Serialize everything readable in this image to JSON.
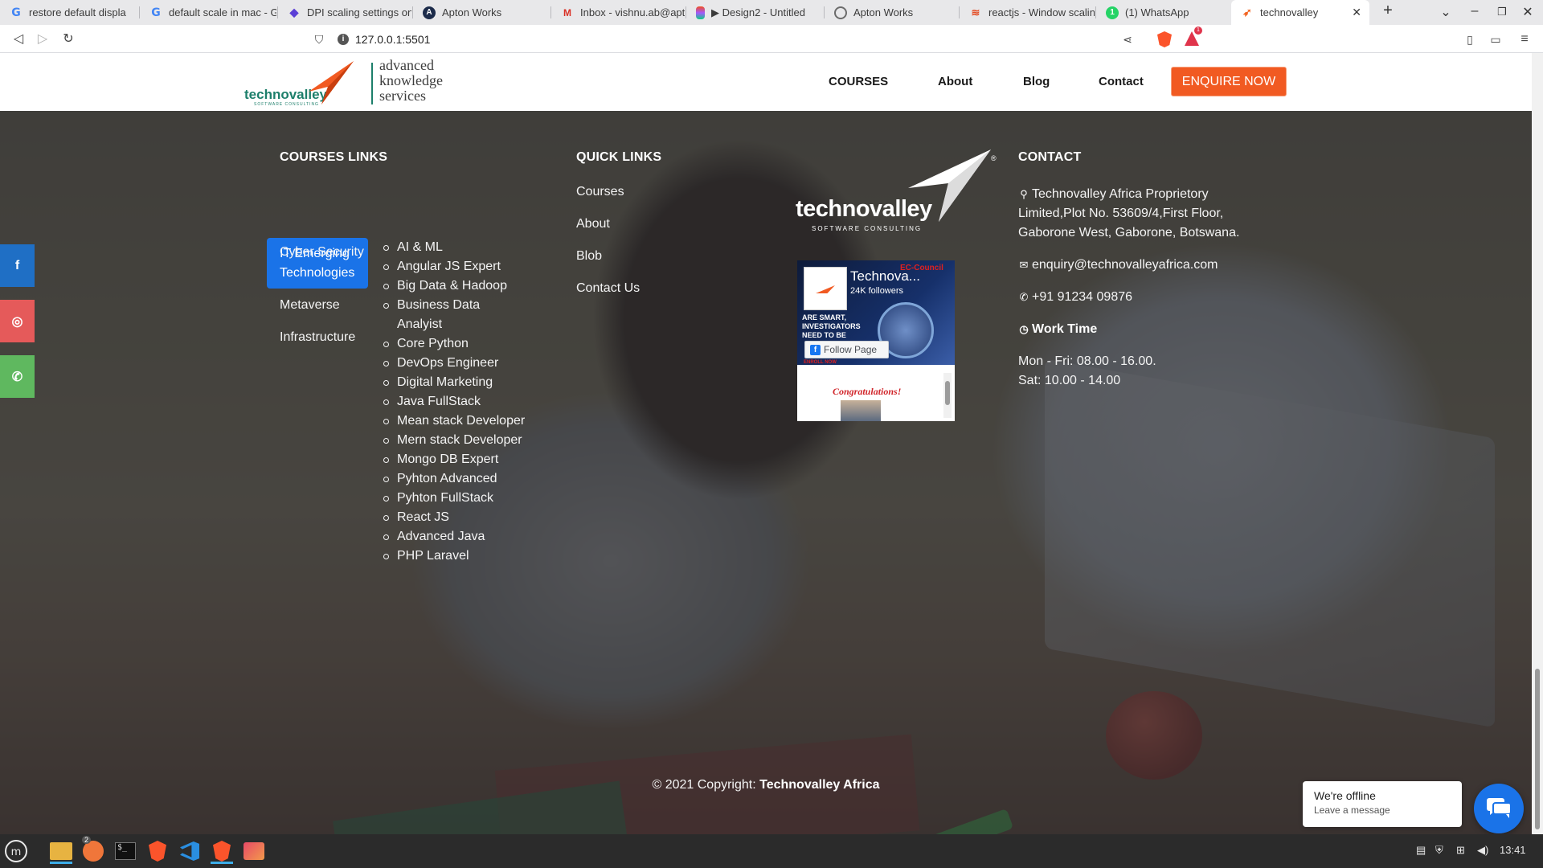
{
  "browser": {
    "tabs": [
      {
        "title": "restore default displa",
        "icon": "google-icon"
      },
      {
        "title": "default scale in mac - G",
        "icon": "google-icon"
      },
      {
        "title": "DPI scaling settings on",
        "icon": "diamond-icon"
      },
      {
        "title": "Apton Works",
        "icon": "apton-icon"
      },
      {
        "title": "Inbox - vishnu.ab@apt",
        "icon": "gmail-icon"
      },
      {
        "title": "▶ Design2 - Untitled",
        "icon": "figma-icon"
      },
      {
        "title": "Apton Works",
        "icon": "globe-icon"
      },
      {
        "title": "reactjs - Window scalin",
        "icon": "stackoverflow-icon"
      },
      {
        "title": "(1) WhatsApp",
        "icon": "whatsapp-icon"
      },
      {
        "title": "technovalley",
        "icon": "technovalley-icon"
      }
    ],
    "url": "127.0.0.1:5501",
    "rewards_badge": "1"
  },
  "header": {
    "logo_word": "technovalley",
    "logo_sub": "SOFTWARE CONSULTING",
    "logo_tagline": [
      "advanced",
      "knowledge",
      "services"
    ],
    "nav": [
      "COURSES",
      "About",
      "Blog",
      "Contact"
    ],
    "cta": "ENQUIRE NOW"
  },
  "footer": {
    "courses_title": "COURSES LINKS",
    "categories": [
      "IT Emerging Technologies",
      "Cyber Security",
      "Metaverse",
      "Infrastructure"
    ],
    "active_category": "IT Emerging Technologies",
    "courses": [
      "AI & ML",
      "Angular JS Expert",
      "Big Data & Hadoop",
      "Business Data Analyist",
      "Core Python",
      "DevOps Engineer",
      "Digital Marketing",
      "Java FullStack",
      "Mean stack Developer",
      "Mern stack Developer",
      "Mongo DB Expert",
      "Pyhton Advanced",
      "Pyhton FullStack",
      "React JS",
      "Advanced Java",
      "PHP Laravel"
    ],
    "quick_title": "QUICK LINKS",
    "quick_links": [
      "Courses",
      "About",
      "Blob",
      "Contact Us"
    ],
    "center_logo_word": "technovalley",
    "center_logo_sub": "SOFTWARE CONSULTING",
    "facebook": {
      "page_name": "Technova...",
      "followers": "24K followers",
      "cover_tag": "EC-Council",
      "cover_promo": "ARE SMART, INVESTIGATORS NEED TO BE",
      "follow_label": "Follow Page",
      "enroll": "ENROLL NOW",
      "post_title": "Congratulations!"
    },
    "contact_title": "CONTACT",
    "address": "Technovalley Africa Proprietory Limited,Plot No. 53609/4,First Floor, Gaborone West, Gaborone, Botswana.",
    "email": "enquiry@technovalleyafrica.com",
    "phone": "+91 91234 09876",
    "work_time_title": "Work Time",
    "hours_weekday": "Mon - Fri: 08.00 - 16.00.",
    "hours_saturday": "Sat: 10.00 - 14.00",
    "copyright_prefix": "© 2021 Copyright:",
    "copyright_brand": "Technovalley Africa"
  },
  "social": [
    {
      "name": "facebook",
      "glyph": "f",
      "color": "#1f6fc5"
    },
    {
      "name": "instagram",
      "glyph": "◎",
      "color": "#e55a5a"
    },
    {
      "name": "whatsapp",
      "glyph": "✆",
      "color": "#5fb85f"
    }
  ],
  "chat": {
    "title": "We're offline",
    "subtitle": "Leave a message"
  },
  "taskbar": {
    "clock": "13:41",
    "files_badge": "2"
  }
}
